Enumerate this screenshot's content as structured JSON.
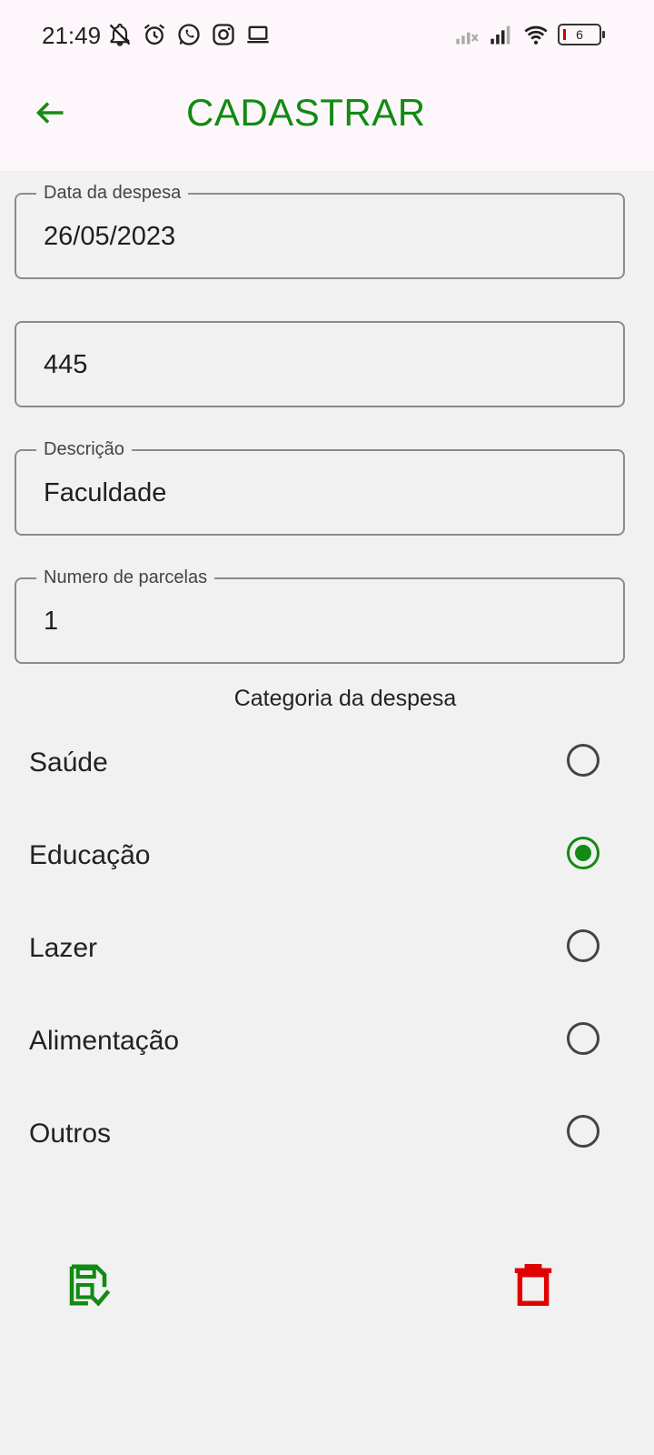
{
  "status_bar": {
    "time": "21:49",
    "battery_level": "6",
    "icons_left": [
      "bell-off-icon",
      "alarm-icon",
      "whatsapp-icon",
      "instagram-icon",
      "laptop-icon"
    ],
    "icons_right": [
      "signal-off-icon",
      "signal-icon",
      "wifi-icon",
      "battery-icon"
    ]
  },
  "app_bar": {
    "title": "CADASTRAR",
    "accent_color": "#138a13"
  },
  "form": {
    "fields": [
      {
        "label": "Data da despesa",
        "value": "26/05/2023"
      },
      {
        "label": "",
        "value": "445"
      },
      {
        "label": "Descrição",
        "value": "Faculdade"
      },
      {
        "label": "Numero de parcelas",
        "value": "1"
      }
    ],
    "category_title": "Categoria da despesa",
    "categories": [
      {
        "label": "Saúde",
        "selected": false
      },
      {
        "label": "Educação",
        "selected": true
      },
      {
        "label": "Lazer",
        "selected": false
      },
      {
        "label": "Alimentação",
        "selected": false
      },
      {
        "label": "Outros",
        "selected": false
      }
    ]
  },
  "actions": {
    "save_icon": "save-icon",
    "delete_icon": "delete-icon",
    "delete_color": "#e00000"
  }
}
